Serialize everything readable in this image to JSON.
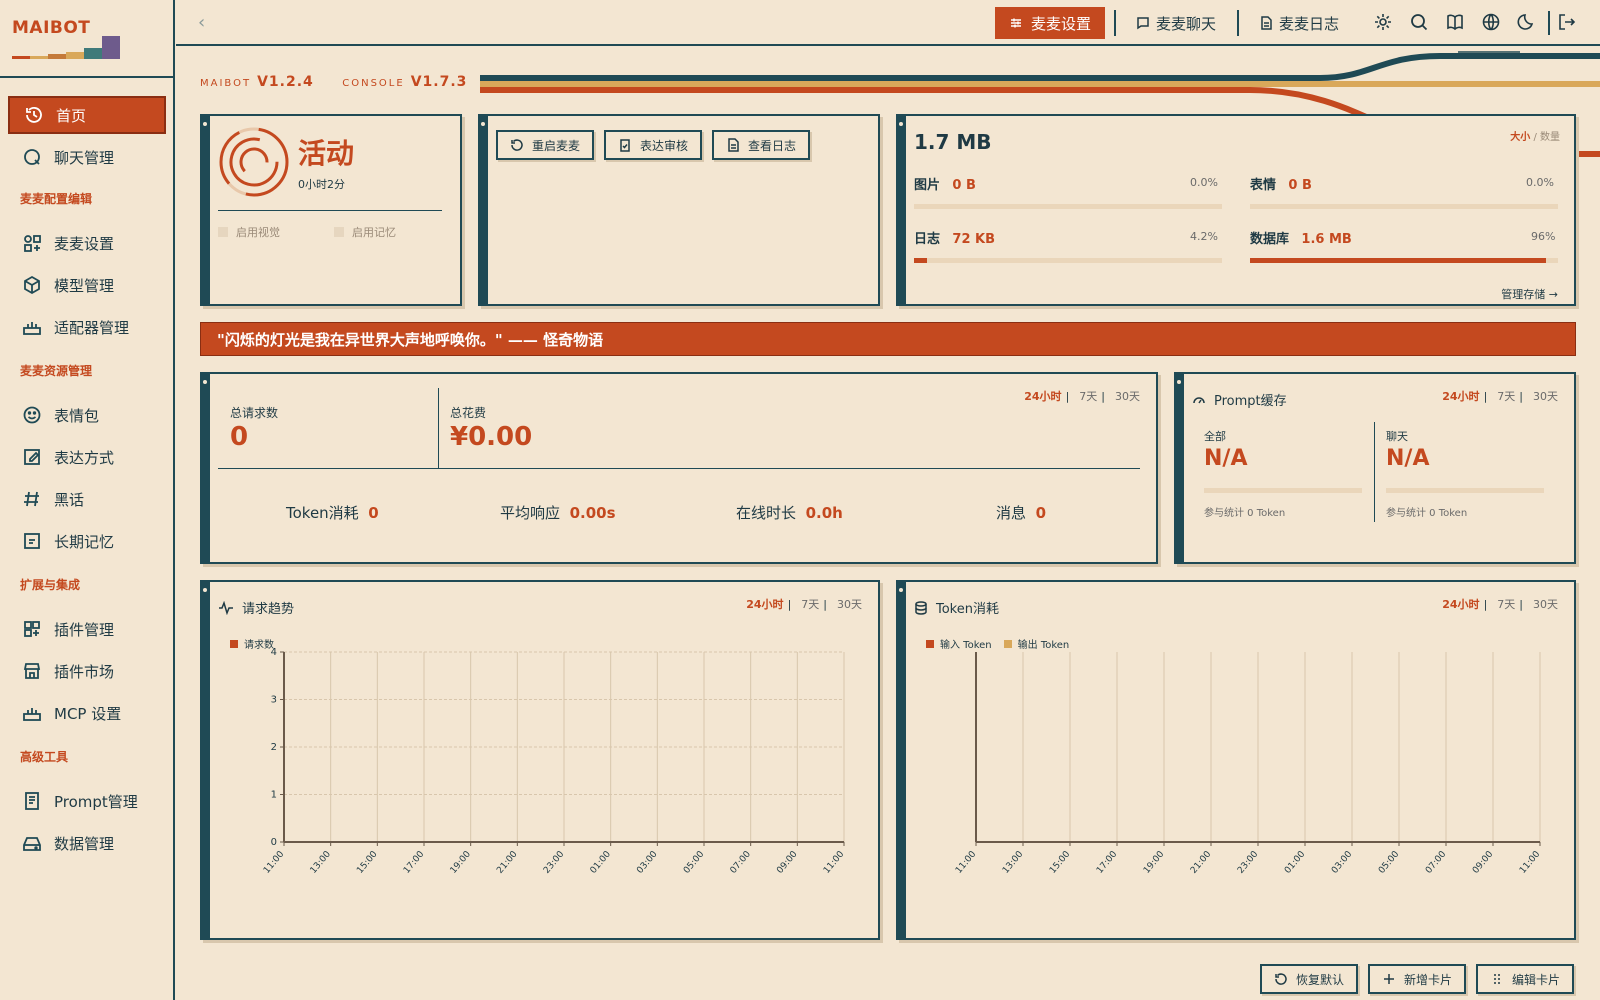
{
  "brand": {
    "name": "MAIBOT"
  },
  "sidebar": {
    "items": [
      {
        "key": "home",
        "label": "首页",
        "icon": "history-icon",
        "active": true
      },
      {
        "key": "chat-manage",
        "label": "聊天管理",
        "icon": "chat-icon"
      },
      {
        "key": "maimai-settings",
        "label": "麦麦设置",
        "icon": "shapes-icon"
      },
      {
        "key": "model-manage",
        "label": "模型管理",
        "icon": "cube-icon"
      },
      {
        "key": "adapter-manage",
        "label": "适配器管理",
        "icon": "router-icon"
      },
      {
        "key": "stickers",
        "label": "表情包",
        "icon": "smile-icon"
      },
      {
        "key": "expressions",
        "label": "表达方式",
        "icon": "edit-icon"
      },
      {
        "key": "slang",
        "label": "黑话",
        "icon": "hash-icon"
      },
      {
        "key": "long-memory",
        "label": "长期记忆",
        "icon": "memory-icon"
      },
      {
        "key": "plugin-manage",
        "label": "插件管理",
        "icon": "grid-icon"
      },
      {
        "key": "plugin-market",
        "label": "插件市场",
        "icon": "store-icon"
      },
      {
        "key": "mcp-settings",
        "label": "MCP 设置",
        "icon": "router-icon"
      },
      {
        "key": "prompt-manage",
        "label": "Prompt管理",
        "icon": "doc-icon"
      },
      {
        "key": "data-manage",
        "label": "数据管理",
        "icon": "drive-icon"
      }
    ],
    "groups": [
      "麦麦配置编辑",
      "麦麦资源管理",
      "扩展与集成",
      "高级工具"
    ]
  },
  "topbar": {
    "tabs": [
      {
        "label": "麦麦设置",
        "icon": "sliders-icon",
        "active": true
      },
      {
        "label": "麦麦聊天",
        "icon": "message-icon"
      },
      {
        "label": "麦麦日志",
        "icon": "file-icon"
      }
    ],
    "icons": [
      "gear-icon",
      "search-icon",
      "book-icon",
      "globe-icon",
      "moon-icon",
      "logout-icon"
    ]
  },
  "version": {
    "maibot_label": "MAIBOT",
    "maibot_version": "V1.2.4",
    "console_label": "CONSOLE",
    "console_version": "V1.7.3"
  },
  "status_card": {
    "status": "活动",
    "uptime": "0小时2分",
    "toggle_vision": "启用视觉",
    "toggle_memory": "启用记忆"
  },
  "actions_card": {
    "buttons": [
      "重启麦麦",
      "表达审核",
      "查看日志"
    ]
  },
  "storage_card": {
    "total": "1.7 MB",
    "mode_size": "大小",
    "mode_sep": "/",
    "mode_count": "数量",
    "items": [
      {
        "label": "图片",
        "value": "0 B",
        "percent_text": "0.0%",
        "percent": 0.0
      },
      {
        "label": "表情",
        "value": "0 B",
        "percent_text": "0.0%",
        "percent": 0.0
      },
      {
        "label": "日志",
        "value": "72 KB",
        "percent_text": "4.2%",
        "percent": 4.2
      },
      {
        "label": "数据库",
        "value": "1.6 MB",
        "percent_text": "96%",
        "percent": 96
      }
    ],
    "manage_link": "管理存储 →"
  },
  "quote": "\"闪烁的灯光是我在异世界大声地呼唤你。\" —— 怪奇物语",
  "ranges": [
    "24小时",
    "7天",
    "30天"
  ],
  "stats_card": {
    "total_requests_label": "总请求数",
    "total_requests": "0",
    "total_cost_label": "总花费",
    "total_cost": "¥0.00",
    "metrics": [
      {
        "label": "Token消耗",
        "value": "0"
      },
      {
        "label": "平均响应",
        "value": "0.00s"
      },
      {
        "label": "在线时长",
        "value": "0.0h"
      },
      {
        "label": "消息",
        "value": "0"
      }
    ]
  },
  "prompt_cache_card": {
    "title": "Prompt缓存",
    "cols": [
      {
        "label": "全部",
        "value": "N/A",
        "note": "参与统计 0 Token"
      },
      {
        "label": "聊天",
        "value": "N/A",
        "note": "参与统计 0 Token"
      }
    ]
  },
  "request_trend": {
    "title": "请求趋势",
    "legend": "请求数"
  },
  "token_usage": {
    "title": "Token消耗",
    "legend_in": "输入 Token",
    "legend_out": "输出 Token"
  },
  "chart_data": [
    {
      "type": "line",
      "title": "请求趋势",
      "x": [
        "11:00",
        "13:00",
        "15:00",
        "17:00",
        "19:00",
        "21:00",
        "23:00",
        "01:00",
        "03:00",
        "05:00",
        "07:00",
        "09:00",
        "11:00"
      ],
      "series": [
        {
          "name": "请求数",
          "values": [
            0,
            0,
            0,
            0,
            0,
            0,
            0,
            0,
            0,
            0,
            0,
            0,
            0
          ]
        }
      ],
      "ylim": [
        0,
        4
      ],
      "yticks": [
        "0",
        "1",
        "2",
        "3",
        "4"
      ],
      "grid": true,
      "legend": "top-left",
      "colors": [
        "#c4491f"
      ]
    },
    {
      "type": "bar",
      "title": "Token消耗",
      "x": [
        "11:00",
        "13:00",
        "15:00",
        "17:00",
        "19:00",
        "21:00",
        "23:00",
        "01:00",
        "03:00",
        "05:00",
        "07:00",
        "09:00",
        "11:00"
      ],
      "series": [
        {
          "name": "输入 Token",
          "values": [
            0,
            0,
            0,
            0,
            0,
            0,
            0,
            0,
            0,
            0,
            0,
            0,
            0
          ]
        },
        {
          "name": "输出 Token",
          "values": [
            0,
            0,
            0,
            0,
            0,
            0,
            0,
            0,
            0,
            0,
            0,
            0,
            0
          ]
        }
      ],
      "grid": true,
      "legend": "top-left",
      "colors": [
        "#c4491f",
        "#d9a85a"
      ]
    }
  ],
  "bottom_buttons": [
    "恢复默认",
    "新增卡片",
    "编辑卡片"
  ],
  "colors": {
    "accent": "#c4491f",
    "dark": "#1f4a55",
    "bg": "#f3e6d2",
    "gold": "#d9a85a"
  }
}
